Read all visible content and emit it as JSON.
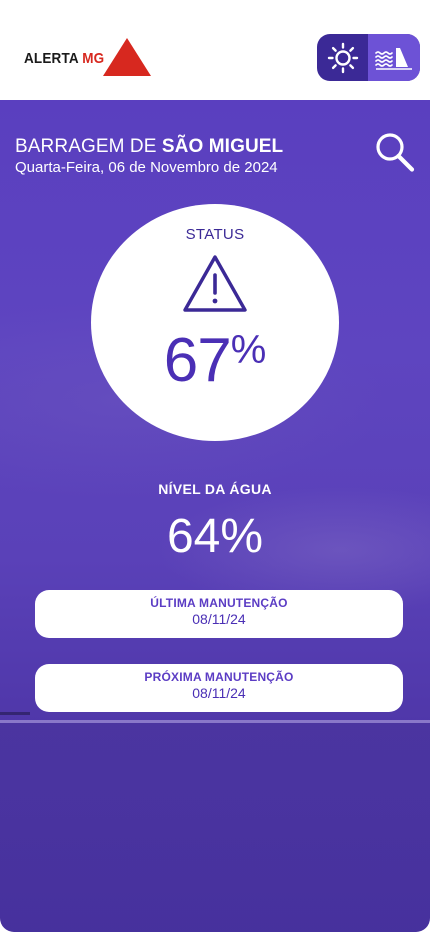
{
  "header": {
    "logo_text": "ALERTA",
    "logo_accent": "MG",
    "toggle": {
      "weather_icon": "sun-icon",
      "dam_icon": "dam-water-icon",
      "active": "dam"
    }
  },
  "dam": {
    "title_prefix": "BARRAGEM DE",
    "title_name": "SÃO MIGUEL",
    "date": "Quarta-Feira, 06 de Novembro de 2024"
  },
  "status": {
    "label": "STATUS",
    "icon": "warning-icon",
    "value": "67",
    "unit": "%"
  },
  "water_level": {
    "label": "NÍVEL DA ÁGUA",
    "value": "64%"
  },
  "maintenance": {
    "last": {
      "label": "ÚLTIMA MANUTENÇÃO",
      "date": "08/11/24"
    },
    "next": {
      "label": "PRÓXIMA MANUTENÇÃO",
      "date": "08/11/24"
    }
  },
  "colors": {
    "brand_red": "#d7281f",
    "primary_purple": "#4a2fb5",
    "toggle_dark": "#3b2996",
    "toggle_active": "#6d52d6"
  }
}
